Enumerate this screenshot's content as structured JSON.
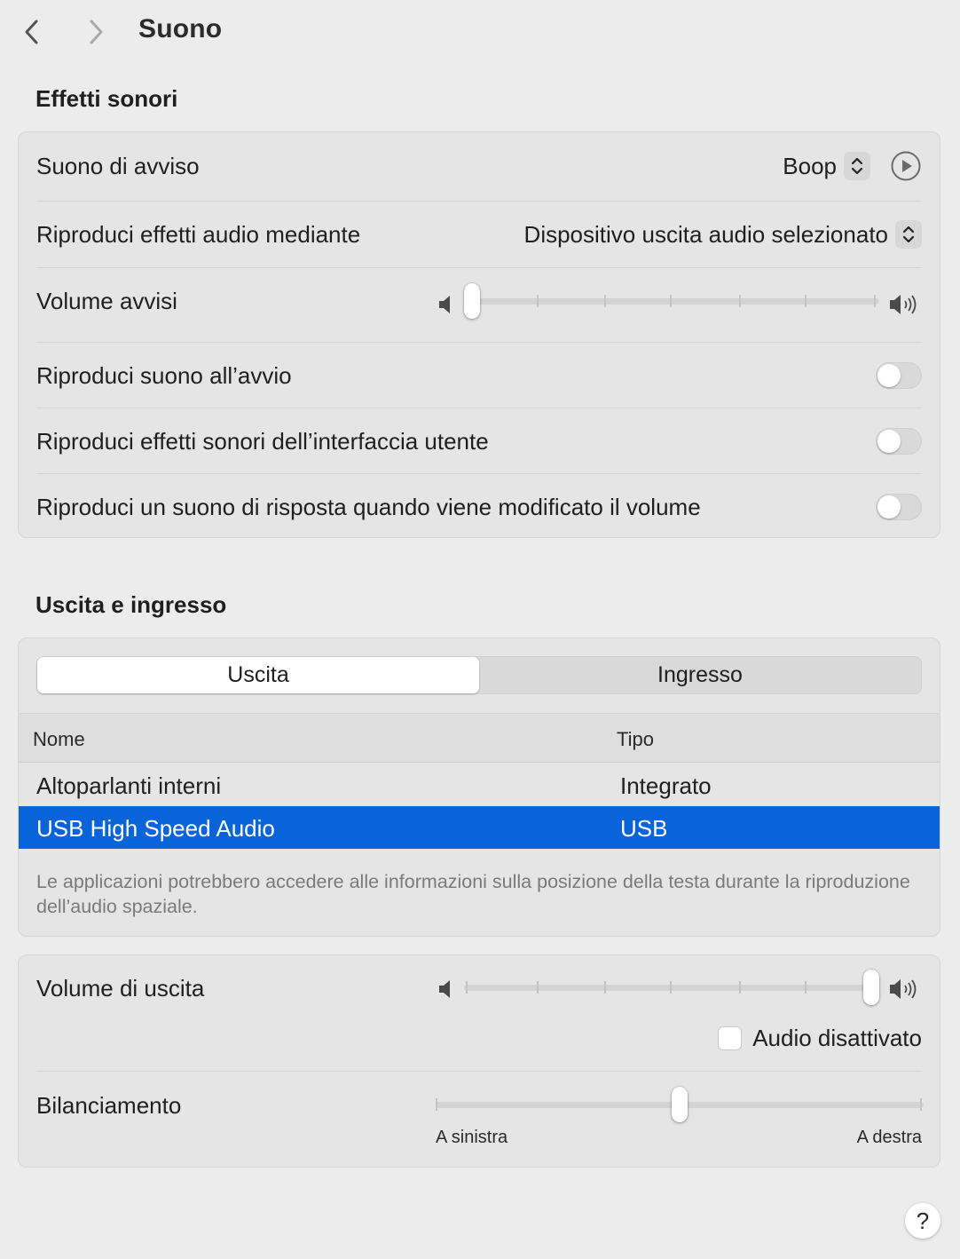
{
  "nav": {
    "title": "Suono"
  },
  "sound_effects": {
    "heading": "Effetti sonori",
    "alert_sound": {
      "label": "Suono di avviso",
      "value": "Boop"
    },
    "play_through": {
      "label": "Riproduci effetti audio mediante",
      "value": "Dispositivo uscita audio selezionato"
    },
    "alert_volume": {
      "label": "Volume avvisi",
      "level_fraction": 0.0
    },
    "startup_sound": {
      "label": "Riproduci suono all’avvio",
      "on": false
    },
    "ui_sounds": {
      "label": "Riproduci effetti sonori dell’interfaccia utente",
      "on": false
    },
    "volume_feedback": {
      "label": "Riproduci un suono di risposta quando viene modificato il volume",
      "on": false
    }
  },
  "io": {
    "heading": "Uscita e ingresso",
    "tabs": [
      "Uscita",
      "Ingresso"
    ],
    "active_tab": "Uscita",
    "columns": {
      "name": "Nome",
      "type": "Tipo"
    },
    "devices": [
      {
        "name": "Altoparlanti interni",
        "type": "Integrato",
        "selected": false
      },
      {
        "name": "USB High Speed Audio",
        "type": "USB",
        "selected": true
      }
    ],
    "footnote": "Le applicazioni potrebbero accedere alle informazioni sulla posizione della testa durante la riproduzione dell’audio spaziale."
  },
  "output": {
    "volume": {
      "label": "Volume di uscita",
      "level_fraction": 1.0
    },
    "mute": {
      "label": "Audio disattivato",
      "checked": false
    },
    "balance": {
      "label": "Bilanciamento",
      "left_label": "A sinistra",
      "right_label": "A destra",
      "level_fraction": 0.5
    }
  },
  "help": {
    "label": "?"
  },
  "colors": {
    "selection": "#0864d8",
    "background": "#ececec",
    "card": "#e5e5e5"
  }
}
